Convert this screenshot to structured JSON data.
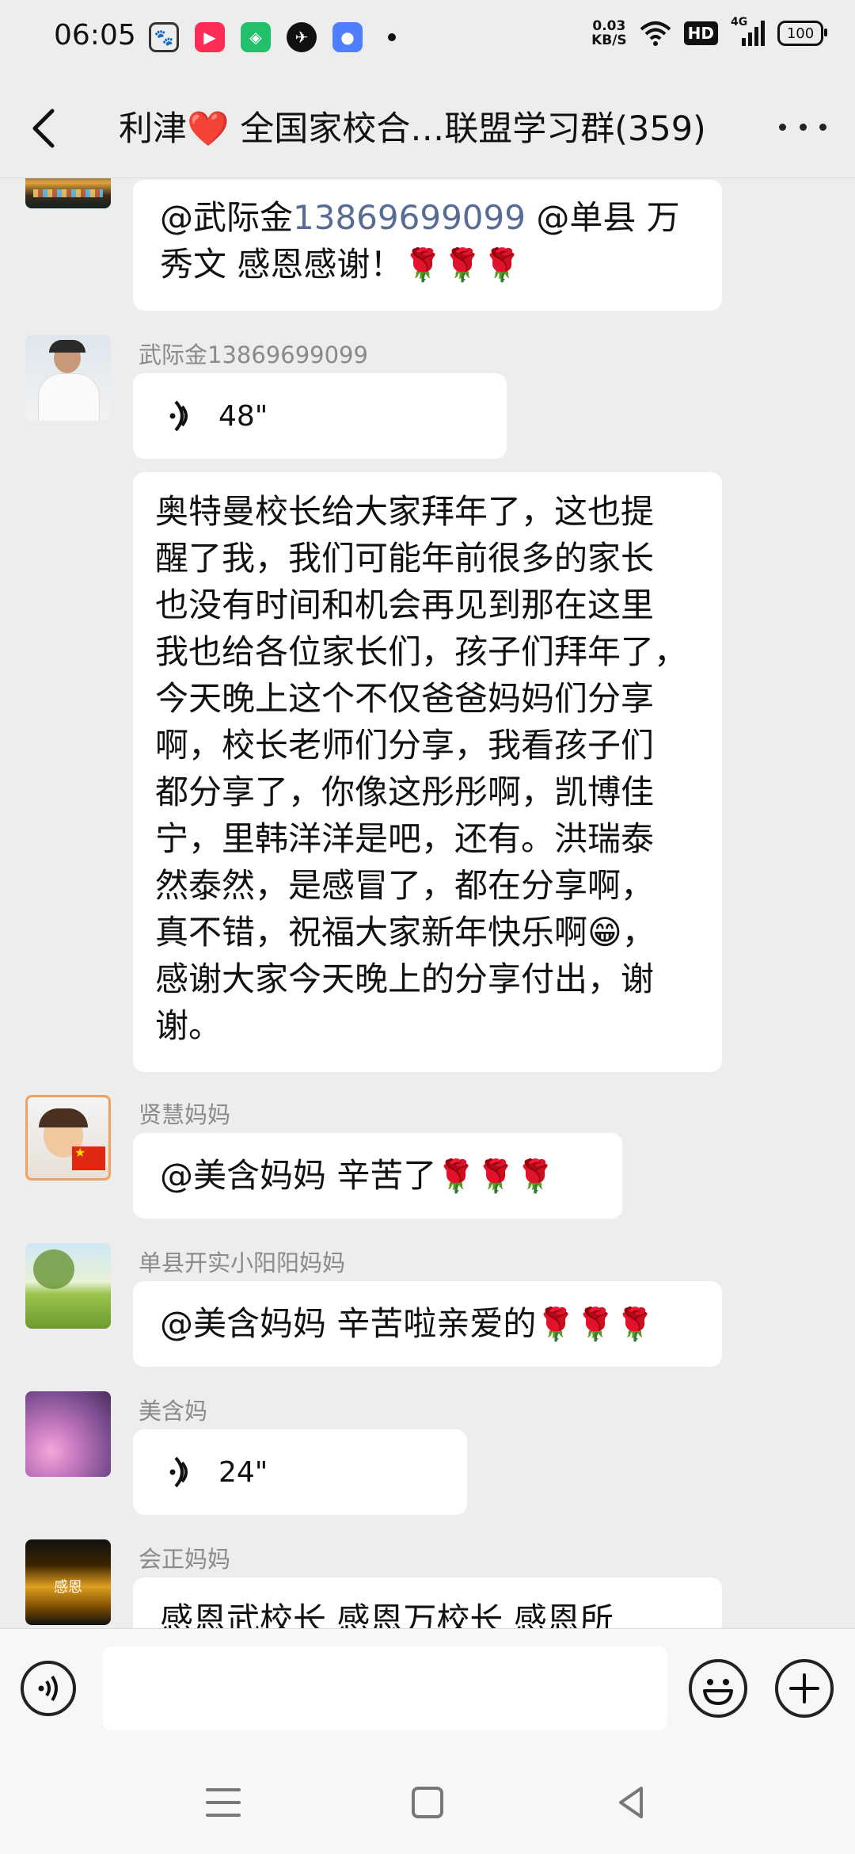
{
  "status_bar": {
    "time": "06:05",
    "apps": [
      {
        "icon": "paw-app-icon",
        "color": "#333333"
      },
      {
        "icon": "kuaishou-app-icon",
        "color": "#ff2d55"
      },
      {
        "icon": "shopping-app-icon",
        "color": "#22c06b"
      },
      {
        "icon": "bird-app-icon",
        "color": "#111111"
      },
      {
        "icon": "chat-app-icon",
        "color": "#4f7fff"
      }
    ],
    "net_speed_value": "0.03",
    "net_speed_unit": "KB/S",
    "hd": "HD",
    "network": "4G",
    "battery": "100"
  },
  "header": {
    "title": "利津❤️ 全国家校合…联盟学习群(359)"
  },
  "messages": [
    {
      "sender": "",
      "avatar": "city-night-avatar",
      "mention": "@武际金",
      "phone": "13869699099",
      "line1_rest": " @单县 万",
      "line2": "秀文  感恩感谢！",
      "emoji": "🌹🌹🌹"
    },
    {
      "sender": "武际金13869699099",
      "avatar": "man-portrait-avatar",
      "voice_length": "48\"",
      "text_lines": [
        "奥特曼校长给大家拜年了，这也提",
        "醒了我，我们可能年前很多的家长",
        "也没有时间和机会再见到那在这里",
        "我也给各位家长们，孩子们拜年了，",
        "今天晚上这个不仅爸爸妈妈们分享",
        "啊，校长老师们分享，我看孩子们",
        "都分享了，你像这彤彤啊，凯博佳",
        "宁，里韩洋洋是吧，还有。洪瑞泰",
        "然泰然，是感冒了，都在分享啊，",
        "真不错，祝福大家新年快乐啊😁，",
        "感谢大家今天晚上的分享付出，谢",
        "谢。"
      ]
    },
    {
      "sender": "贤慧妈妈",
      "avatar": "child-flag-avatar",
      "text": "@美含妈妈  辛苦了",
      "emoji": "🌹🌹🌹"
    },
    {
      "sender": "单县开实小阳阳妈妈",
      "avatar": "meadow-tree-avatar",
      "text": "@美含妈妈  辛苦啦亲爱的",
      "emoji": "🌹🌹🌹"
    },
    {
      "sender": "美含妈",
      "avatar": "pink-flowers-avatar",
      "voice_length": "24\""
    },
    {
      "sender": "会正妈妈",
      "avatar": "gratitude-hands-avatar",
      "avatar_text": "感恩",
      "text": "感恩武校长  感恩万校长  感恩所"
    }
  ],
  "input_bar": {
    "voice_icon": "voice-input-icon",
    "emoji_icon": "emoji-icon",
    "plus_icon": "plus-icon"
  },
  "nav_bar": {
    "menu_icon": "menu-icon",
    "home_icon": "home-icon",
    "back_icon": "back-triangle-icon"
  }
}
